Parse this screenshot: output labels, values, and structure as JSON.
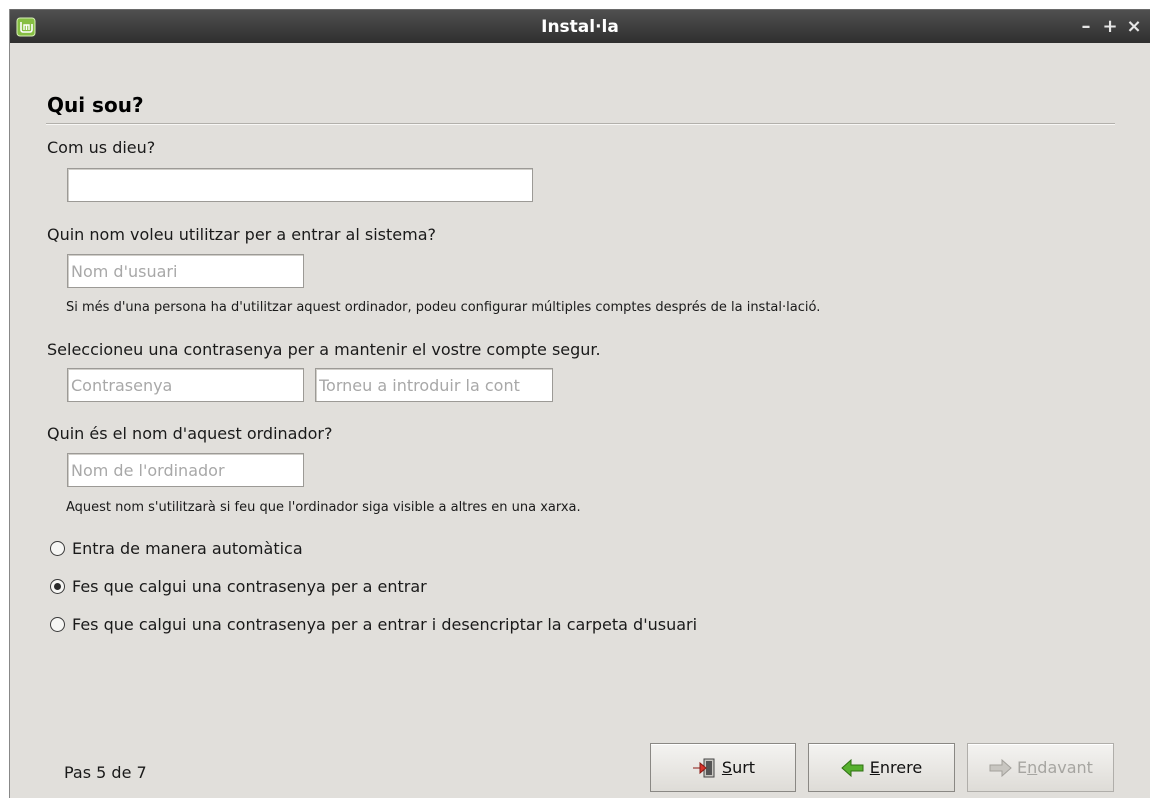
{
  "window": {
    "title": "Instal·la",
    "controls": {
      "minimize": "–",
      "maximize": "+",
      "close": "×"
    }
  },
  "page": {
    "title": "Qui sou?",
    "name_label": "Com us dieu?",
    "name_value": "",
    "username_label": "Quin nom voleu utilitzar per a entrar al sistema?",
    "username_placeholder": "Nom d'usuari",
    "username_hint": "Si més d'una persona ha d'utilitzar aquest ordinador, podeu configurar múltiples comptes després de la instal·lació.",
    "password_label": "Seleccioneu una contrasenya per a mantenir el vostre compte segur.",
    "password_placeholder": "Contrasenya",
    "password_confirm_placeholder": "Torneu a introduir la cont",
    "hostname_label": "Quin és el nom d'aquest ordinador?",
    "hostname_placeholder": "Nom de l'ordinador",
    "hostname_hint": "Aquest nom s'utilitzarà si feu que l'ordinador siga visible a altres en una xarxa.",
    "login_options": [
      {
        "label": "Entra de manera automàtica",
        "checked": false
      },
      {
        "label": "Fes que calgui una contrasenya per a entrar",
        "checked": true
      },
      {
        "label": "Fes que calgui una contrasenya per a entrar i desencriptar la carpeta d'usuari",
        "checked": false
      }
    ]
  },
  "footer": {
    "step_text": "Pas 5 de 7",
    "quit": {
      "mnemonic": "S",
      "rest": "urt",
      "icon": "exit-door-icon"
    },
    "back": {
      "mnemonic": "E",
      "rest": "nrere",
      "icon": "arrow-left-icon"
    },
    "forward": {
      "first": "E",
      "mnemonic": "n",
      "rest": "davant",
      "icon": "arrow-right-icon",
      "enabled": false
    }
  },
  "colors": {
    "window_bg": "#e1dfdb",
    "titlebar": "#3c3c3c",
    "mint_green": "#86be43",
    "arrow_green": "#57b02f",
    "exit_red": "#d9342b"
  }
}
